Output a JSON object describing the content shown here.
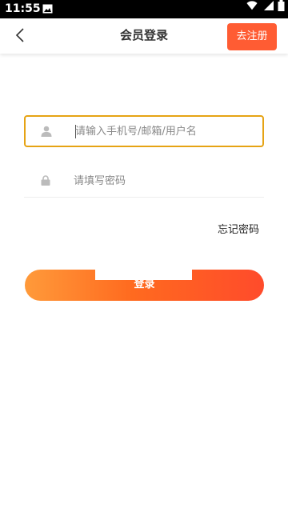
{
  "status_bar": {
    "time": "11:55",
    "icons": [
      "photo-icon",
      "wifi-icon",
      "signal-icon",
      "battery-icon"
    ]
  },
  "nav": {
    "back_icon": "chevron-left-icon",
    "title": "会员登录",
    "register_label": "去注册"
  },
  "form": {
    "username": {
      "placeholder": "请输入手机号/邮箱/用户名",
      "value": "",
      "icon": "user-icon"
    },
    "password": {
      "placeholder": "请填写密码",
      "value": "",
      "icon": "lock-icon"
    },
    "forgot_label": "忘记密码",
    "login_label": "登录"
  },
  "colors": {
    "accent": "#ff5c33",
    "focus_border": "#e6a314",
    "gradient_start": "#ff9a3a",
    "gradient_end": "#ff4b2b"
  }
}
